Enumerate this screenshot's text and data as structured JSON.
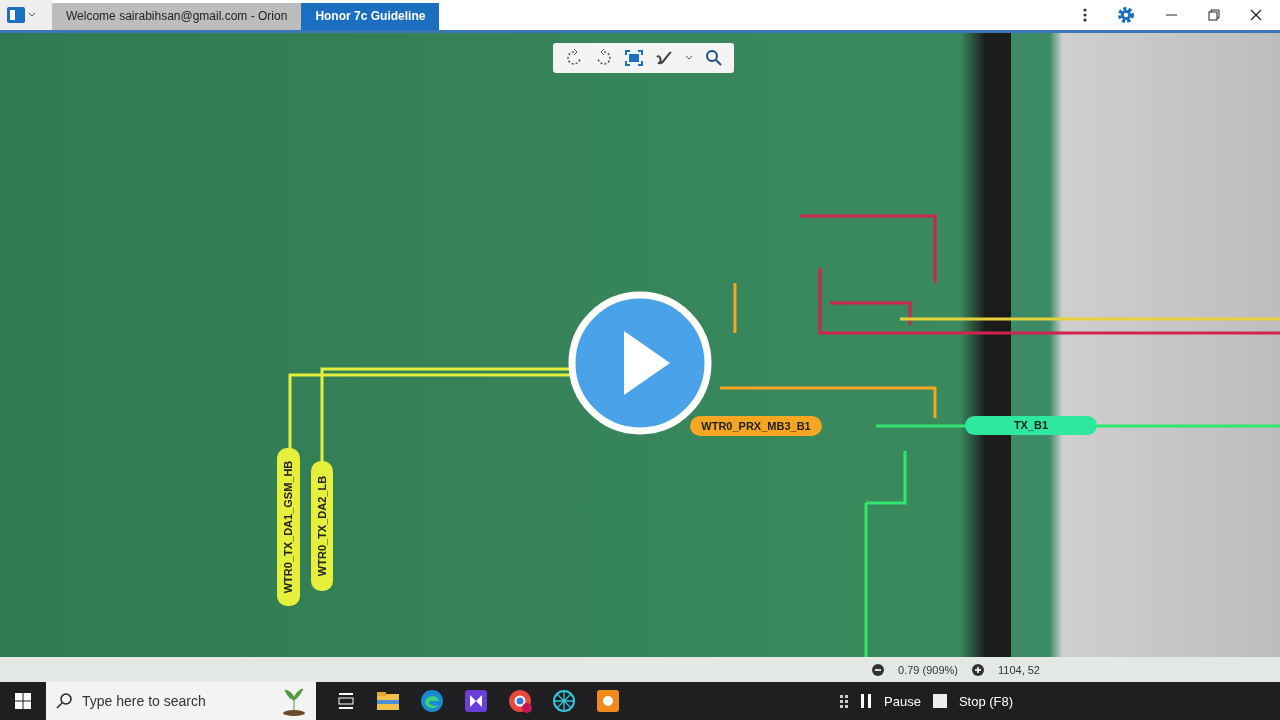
{
  "title_bar": {
    "tabs": [
      {
        "label": "Welcome sairabihsan@gmail.com - Orion",
        "selected": false
      },
      {
        "label": "Honor 7c Guideline",
        "selected": true
      }
    ]
  },
  "viewer": {
    "nets": [
      {
        "label": "WTR0_TX_DA1_GSM_HB",
        "color": "#e6f03c"
      },
      {
        "label": "WTR0_TX_DA2_LB",
        "color": "#e6f03c"
      },
      {
        "label": "WTR0_PRX_MB3_B1",
        "color": "#f5a623"
      },
      {
        "label": "TX_B1",
        "color": "#2ee8a0"
      }
    ]
  },
  "status_bar": {
    "zoom": "0.79 (909%)",
    "coordinates": "1104, 52"
  },
  "taskbar": {
    "search": {
      "placeholder": "Type here to search"
    },
    "recorder": {
      "pause": "Pause",
      "stop": "Stop (F8)"
    }
  }
}
